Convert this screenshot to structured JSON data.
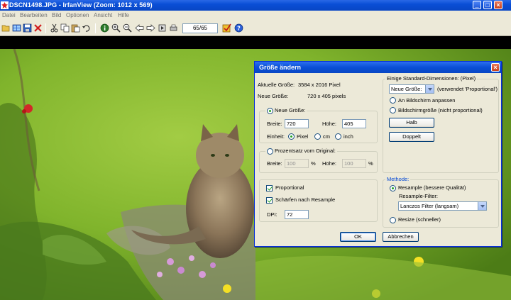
{
  "window": {
    "title": "DSCN1498.JPG - IrfanView (Zoom: 1012 x 569)"
  },
  "menu": [
    "Datei",
    "Bearbeiten",
    "Bild",
    "Optionen",
    "Ansicht",
    "Hilfe"
  ],
  "toolbar": {
    "page_counter": "65/65"
  },
  "dialog": {
    "title": "Größe ändern",
    "current_size_label": "Aktuelle Größe:",
    "current_size_value": "3584 x 2016  Pixel",
    "new_size_label": "Neue Größe:",
    "new_size_value": "720 x 405  pixels",
    "new_size_group": {
      "radio_label": "Neue Größe:",
      "selected": true,
      "width_label": "Breite:",
      "width_value": "720",
      "height_label": "Höhe:",
      "height_value": "405",
      "unit_label": "Einheit:",
      "units": [
        {
          "label": "Pixel",
          "selected": true
        },
        {
          "label": "cm",
          "selected": false
        },
        {
          "label": "inch",
          "selected": false
        }
      ]
    },
    "percent_group": {
      "radio_label": "Prozentsatz vom Original:",
      "selected": false,
      "width_label": "Breite:",
      "width_value": "100",
      "height_label": "Höhe:",
      "height_value": "100",
      "unit": "%"
    },
    "options": {
      "proportional_label": "Proportional",
      "proportional_checked": true,
      "sharpen_label": "Schärfen nach Resample",
      "sharpen_checked": true,
      "dpi_label": "DPI:",
      "dpi_value": "72"
    },
    "standard_dims": {
      "legend": "Einige Standard-Dimensionen: (Pixel)",
      "select_value": "Neue Größe:",
      "select_note": "(verwendet 'Proportional')",
      "fit_screen_label": "An Bildschirm anpassen",
      "screen_size_label": "Bildschirmgröße (nicht proportional)",
      "half_button": "Halb",
      "double_button": "Doppelt"
    },
    "method": {
      "legend": "Methode:",
      "resample_label": "Resample (bessere Qualität)",
      "resample_selected": true,
      "filter_label": "Resample-Filter:",
      "filter_value": "Lanczos Filter (langsam)",
      "resize_label": "Resize (schneller)",
      "resize_selected": false
    },
    "ok_button": "OK",
    "cancel_button": "Abbrechen"
  }
}
